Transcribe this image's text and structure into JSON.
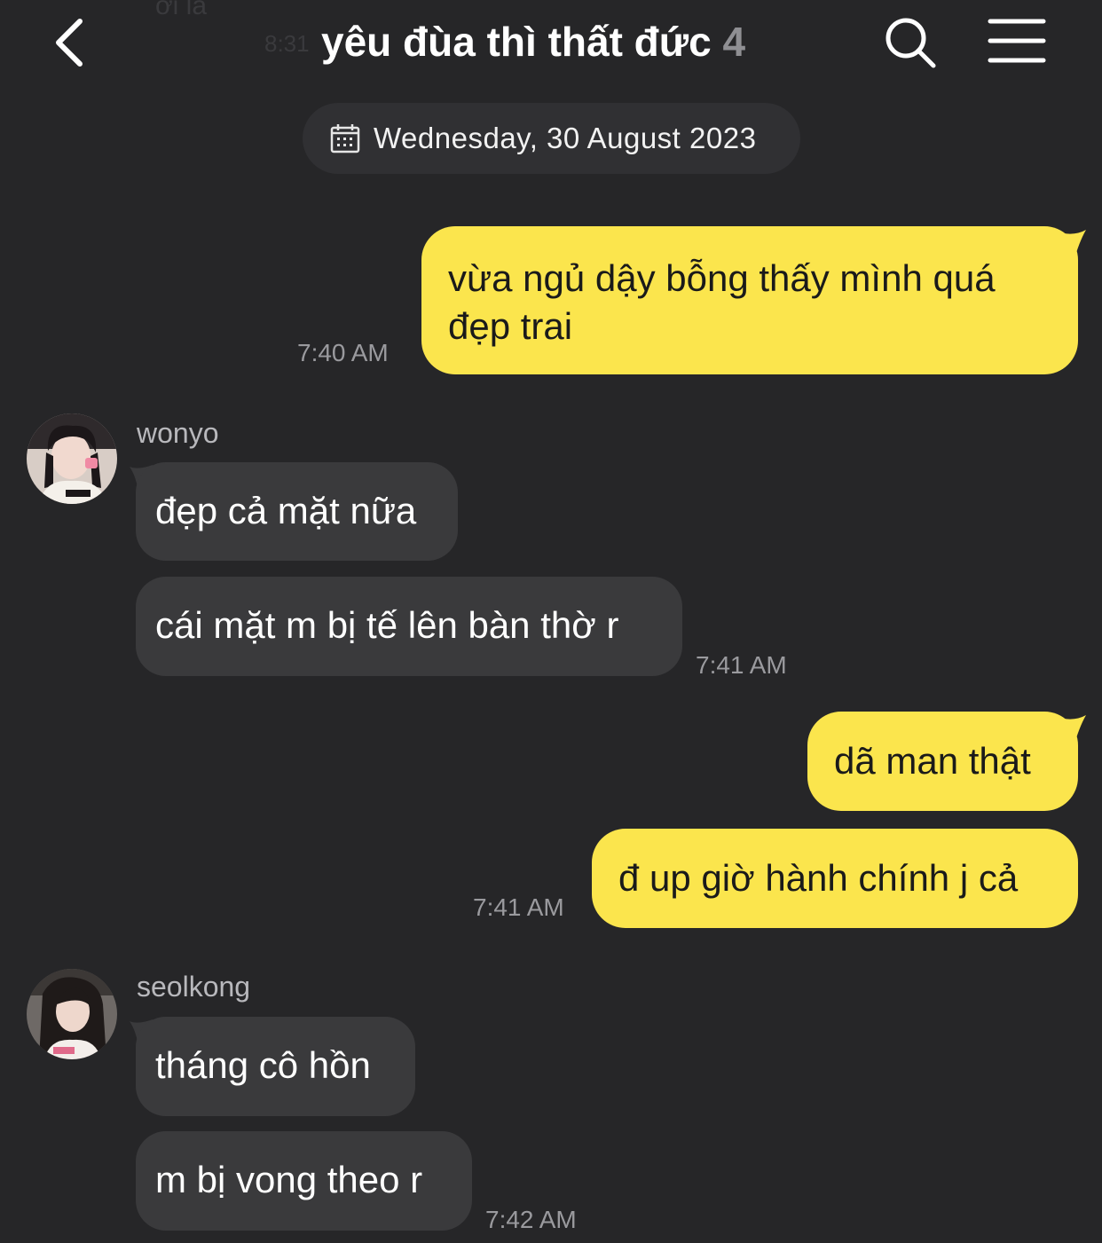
{
  "ghost": {
    "text": "ơi là",
    "time": "8:31"
  },
  "header": {
    "title": "yêu đùa thì thất đức",
    "member_count": "4"
  },
  "date_divider": "Wednesday, 30 August 2023",
  "messages": [
    {
      "side": "out",
      "text": "vừa ngủ dậy bỗng thấy mình quá đẹp trai",
      "time": "7:40 AM"
    },
    {
      "side": "in",
      "sender": "wonyo",
      "text": "đẹp cả mặt nữa"
    },
    {
      "side": "in",
      "text": "cái mặt m bị tế lên bàn thờ r",
      "time": "7:41 AM"
    },
    {
      "side": "out",
      "text": "dã man thật"
    },
    {
      "side": "out",
      "text": "đ up giờ hành chính j cả",
      "time": "7:41 AM"
    },
    {
      "side": "in",
      "sender": "seolkong",
      "text": "tháng cô hồn"
    },
    {
      "side": "in",
      "text": "m bị vong theo r",
      "time": "7:42 AM"
    }
  ],
  "colors": {
    "background": "#262628",
    "outgoing_bubble": "#fbe54d",
    "incoming_bubble": "#3a3a3c",
    "timestamp": "#9a9a9e"
  },
  "icons": {
    "back": "chevron-left-icon",
    "search": "search-icon",
    "menu": "hamburger-menu-icon",
    "date": "calendar-icon"
  }
}
